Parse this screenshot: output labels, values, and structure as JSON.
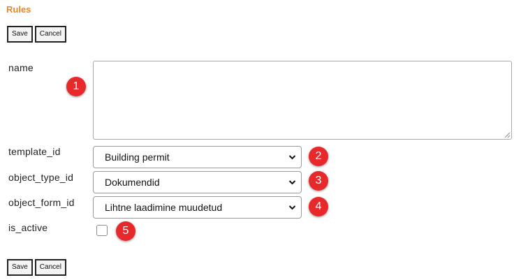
{
  "page": {
    "title": "Rules"
  },
  "toolbar": {
    "save_label": "Save",
    "cancel_label": "Cancel"
  },
  "form": {
    "name": {
      "label": "name",
      "value": ""
    },
    "template_id": {
      "label": "template_id",
      "selected": "Building permit"
    },
    "object_type_id": {
      "label": "object_type_id",
      "selected": "Dokumendid"
    },
    "object_form_id": {
      "label": "object_form_id",
      "selected": "Lihtne laadimine muudetud"
    },
    "is_active": {
      "label": "is_active",
      "checked": false
    }
  },
  "annotations": [
    "1",
    "2",
    "3",
    "4",
    "5"
  ],
  "colors": {
    "title": "#e8862c",
    "badge": "#e8292b"
  }
}
